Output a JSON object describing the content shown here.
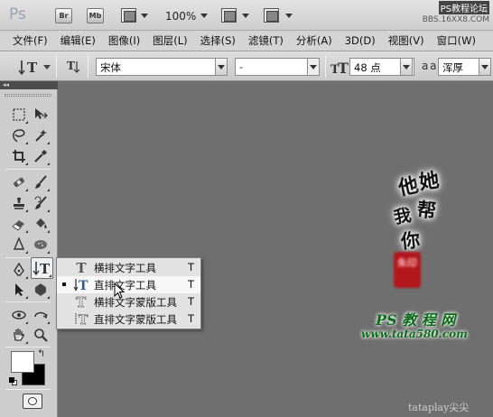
{
  "app": {
    "logo": "Ps",
    "bridge_label": "Br",
    "minibridge_label": "Mb",
    "zoom": "100%",
    "watermark_site": "PS教程论坛",
    "watermark_url": "BBS.16XX8.COM"
  },
  "menubar": {
    "items": [
      "文件(F)",
      "编辑(E)",
      "图像(I)",
      "图层(L)",
      "选择(S)",
      "滤镜(T)",
      "分析(A)",
      "3D(D)",
      "视图(V)",
      "窗口(W)"
    ]
  },
  "options": {
    "font_family": "宋体",
    "font_style": "-",
    "font_size": "48 点",
    "aa_label": "a a",
    "antialias": "浑厚"
  },
  "flyout": {
    "items": [
      {
        "label": "横排文字工具",
        "shortcut": "T",
        "icon": "horizontal-type-icon",
        "selected": false
      },
      {
        "label": "直排文字工具",
        "shortcut": "T",
        "icon": "vertical-type-icon",
        "selected": true
      },
      {
        "label": "横排文字蒙版工具",
        "shortcut": "T",
        "icon": "horizontal-type-mask-icon",
        "selected": false
      },
      {
        "label": "直排文字蒙版工具",
        "shortcut": "T",
        "icon": "vertical-type-mask-icon",
        "selected": false
      }
    ]
  },
  "canvas": {
    "brush_chars": [
      "他",
      "她",
      "我",
      "帮",
      "你"
    ],
    "seal_text": "朱印",
    "signature": "PS 教 程 网",
    "site": "www.tata580.com",
    "watermark": "tataplay尖尖"
  },
  "colors": {
    "canvas_bg": "#6f6f6f",
    "panel_bg": "#cdcdcd",
    "seal_red": "#b3161b",
    "signature_green": "#0d6c1a"
  }
}
